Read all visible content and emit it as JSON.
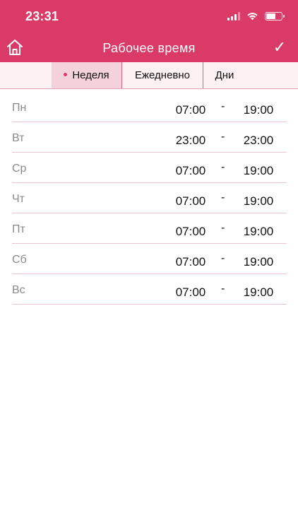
{
  "status_bar": {
    "time": "23:31",
    "icons": [
      "signal-icon",
      "wifi-icon",
      "battery-icon"
    ]
  },
  "nav": {
    "title": "Рабочее время",
    "left_icon": "home-icon",
    "right_icon": "checkmark-icon",
    "right_glyph": "✓"
  },
  "tabs": [
    {
      "label": "Неделя",
      "selected": true
    },
    {
      "label": "Ежедневно",
      "selected": false
    },
    {
      "label": "Дни",
      "selected": false
    }
  ],
  "schedule": [
    {
      "day": "Пн",
      "start": "07:00",
      "separator": "-",
      "end": "19:00"
    },
    {
      "day": "Вт",
      "start": "23:00",
      "separator": "-",
      "end": "23:00"
    },
    {
      "day": "Ср",
      "start": "07:00",
      "separator": "-",
      "end": "19:00"
    },
    {
      "day": "Чт",
      "start": "07:00",
      "separator": "-",
      "end": "19:00"
    },
    {
      "day": "Пт",
      "start": "07:00",
      "separator": "-",
      "end": "19:00"
    },
    {
      "day": "Сб",
      "start": "07:00",
      "separator": "-",
      "end": "19:00"
    },
    {
      "day": "Вс",
      "start": "07:00",
      "separator": "-",
      "end": "19:00"
    }
  ],
  "colors": {
    "brand": "#d93a66",
    "tab_background": "#fdf1f4",
    "tab_selected": "#f4d2dc",
    "divider": "#ecc4cf",
    "day_label": "#8a8a8a"
  }
}
